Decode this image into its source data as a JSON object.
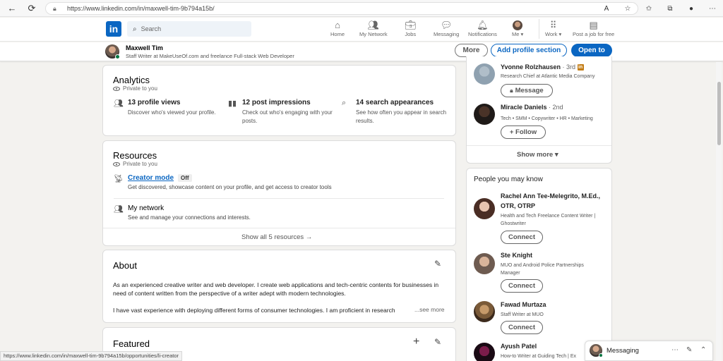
{
  "browser": {
    "url": "https://www.linkedin.com/in/maxwell-tim-9b794a15b/",
    "status_url": "https://www.linkedin.com/in/maxwell-tim-9b794a15b/opportunities/li-creator"
  },
  "nav": {
    "logo": "in",
    "search_placeholder": "Search",
    "items": [
      {
        "label": "Home",
        "icon": "home-icon"
      },
      {
        "label": "My Network",
        "icon": "network-icon"
      },
      {
        "label": "Jobs",
        "icon": "briefcase-icon"
      },
      {
        "label": "Messaging",
        "icon": "chat-icon"
      },
      {
        "label": "Notifications",
        "icon": "bell-icon"
      },
      {
        "label": "Me ▾",
        "icon": "avatar"
      },
      {
        "label": "Work ▾",
        "icon": "grid-icon"
      },
      {
        "label": "Post a job for free",
        "icon": "post-job-icon"
      }
    ]
  },
  "profile_bar": {
    "name": "Maxwell Tim",
    "headline": "Staff Writer at MakeUseOf.com and freelance Full-stack Web Developer",
    "more_label": "More",
    "add_section_label": "Add profile section",
    "open_to_label": "Open to"
  },
  "analytics": {
    "title": "Analytics",
    "private": "Private to you",
    "metrics": [
      {
        "title": "13 profile views",
        "desc": "Discover who's viewed your profile."
      },
      {
        "title": "12 post impressions",
        "desc": "Check out who's engaging with your posts."
      },
      {
        "title": "14 search appearances",
        "desc": "See how often you appear in search results."
      }
    ]
  },
  "resources": {
    "title": "Resources",
    "private": "Private to you",
    "creator_mode": "Creator mode",
    "creator_status": "Off",
    "creator_desc": "Get discovered, showcase content on your profile, and get access to creator tools",
    "network_title": "My network",
    "network_desc": "See and manage your connections and interests.",
    "show_all": "Show all 5 resources →"
  },
  "about": {
    "title": "About",
    "para1": "As an experienced creative writer and web developer. I create web applications and tech-centric contents for businesses in need of content written from the perspective of a writer adept with modern technologies.",
    "para2": "I have vast experience with deploying different forms of consumer technologies. I am proficient in research",
    "see_more": "...see more"
  },
  "featured": {
    "title": "Featured"
  },
  "sidebar_top": {
    "people": [
      {
        "name": "Yvonne Rolzhausen",
        "degree": " · 3rd",
        "headline": "Research Chief at Atlantic Media Company",
        "action": "Message"
      },
      {
        "name": "Miracle Daniels",
        "degree": " · 2nd",
        "headline": "Tech • SMM • Copywriter • HR • Marketing",
        "action": "+ Follow"
      }
    ],
    "show_more": "Show more ▾"
  },
  "pymk": {
    "title": "People you may know",
    "people": [
      {
        "name1": "Rachel Ann Tee-Melegrito, M.Ed.,",
        "name2": "OTR, OTRP",
        "h1": "Health and Tech Freelance Content Writer |",
        "h2": "Ghostwriter",
        "action": "Connect"
      },
      {
        "name1": "Ste Knight",
        "name2": "",
        "h1": "MUO and Android Police Partnerships",
        "h2": "Manager",
        "action": "Connect"
      },
      {
        "name1": "Fawad Murtaza",
        "name2": "",
        "h1": "Staff Writer at MUO",
        "h2": "",
        "action": "Connect"
      },
      {
        "name1": "Ayush Patel",
        "name2": "",
        "h1": "How-to Writer at Guiding Tech | Ex",
        "h2": "",
        "action": ""
      }
    ]
  },
  "messaging": {
    "label": "Messaging"
  },
  "colors": {
    "brand": "#0a66c2",
    "online": "#057642"
  }
}
